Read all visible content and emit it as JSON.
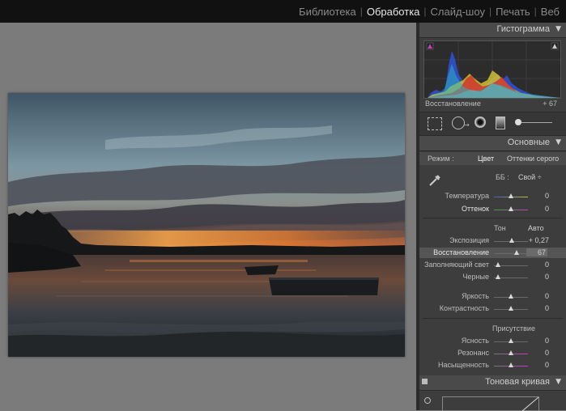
{
  "modules": [
    "Библиотека",
    "Обработка",
    "Слайд-шоу",
    "Печать",
    "Веб"
  ],
  "active_module": "Обработка",
  "histogram": {
    "title": "Гистограмма",
    "footer_label": "Восстановление",
    "footer_value": "+ 67"
  },
  "basic": {
    "title": "Основные",
    "mode_label": "Режим :",
    "mode_color": "Цвет",
    "mode_gray": "Оттенки серого",
    "wb_label": "ББ :",
    "wb_value": "Свой ÷",
    "temperature_label": "Температура",
    "temperature_value": "0",
    "temperature_level": 0.5,
    "tint_label": "Оттенок",
    "tint_value": "0",
    "tint_level": 0.5,
    "tone_label": "Тон",
    "auto_label": "Авто",
    "exposure_label": "Экспозиция",
    "exposure_value": "+ 0,27",
    "exposure_level": 0.53,
    "recovery_label": "Восстановление",
    "recovery_value": "67",
    "recovery_level": 0.67,
    "fill_label": "Заполняющий свет",
    "fill_value": "0",
    "fill_level": 0.0,
    "blacks_label": "Черные",
    "blacks_value": "0",
    "blacks_level": 0.0,
    "brightness_label": "Яркость",
    "brightness_value": "0",
    "brightness_level": 0.5,
    "contrast_label": "Контрастность",
    "contrast_value": "0",
    "contrast_level": 0.5,
    "presence_label": "Присутствие",
    "clarity_label": "Ясность",
    "clarity_value": "0",
    "clarity_level": 0.5,
    "vibrance_label": "Резонанс",
    "vibrance_value": "0",
    "vibrance_level": 0.5,
    "saturation_label": "Насыщенность",
    "saturation_value": "0",
    "saturation_level": 0.5
  },
  "tone_curve": {
    "title": "Тоновая кривая"
  },
  "colors": {
    "panel_bg": "#3d3d3d",
    "canvas_bg": "#7b7b7b",
    "topbar_bg": "#111111",
    "active_text": "#e8e8e8",
    "inactive_text": "#8a8a8a"
  }
}
